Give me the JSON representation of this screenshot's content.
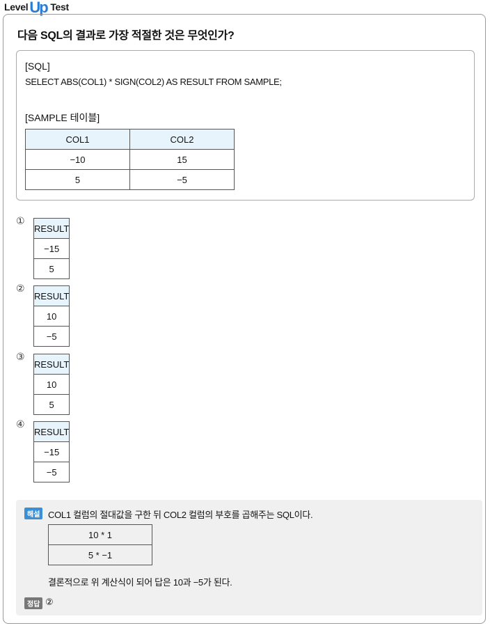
{
  "header": {
    "level": "Level",
    "up": "Up",
    "test": "Test"
  },
  "question": {
    "title": "다음 SQL의 결과로 가장 적절한 것은 무엇인가?",
    "sql_label": "[SQL]",
    "sql_statement": "SELECT ABS(COL1) * SIGN(COL2) AS RESULT FROM SAMPLE;",
    "sample_label": "[SAMPLE 테이블]",
    "sample_table": {
      "headers": [
        "COL1",
        "COL2"
      ],
      "rows": [
        [
          "−10",
          "15"
        ],
        [
          "5",
          "−5"
        ]
      ]
    }
  },
  "options": [
    {
      "number": "①",
      "header": "RESULT",
      "values": [
        "−15",
        "5"
      ]
    },
    {
      "number": "②",
      "header": "RESULT",
      "values": [
        "10",
        "−5"
      ]
    },
    {
      "number": "③",
      "header": "RESULT",
      "values": [
        "10",
        "5"
      ]
    },
    {
      "number": "④",
      "header": "RESULT",
      "values": [
        "−15",
        "−5"
      ]
    }
  ],
  "explanation": {
    "tag": "해설",
    "text": "COL1 컬럼의 절대값을 구한 뒤 COL2 컬럼의 부호를 곱해주는 SQL이다.",
    "calc_rows": [
      "10 * 1",
      "5 * −1"
    ],
    "conclusion": "결론적으로 위 계산식이 되어 답은 10과 −5가 된다.",
    "answer_tag": "정답",
    "answer": "②"
  },
  "colors": {
    "header_cell_bg": "#e8f4fb",
    "explain_bg": "#f0f0f0",
    "explain_tag": "#3a8fd6",
    "answer_tag": "#777777",
    "brand_blue": "#2b7bd6"
  }
}
